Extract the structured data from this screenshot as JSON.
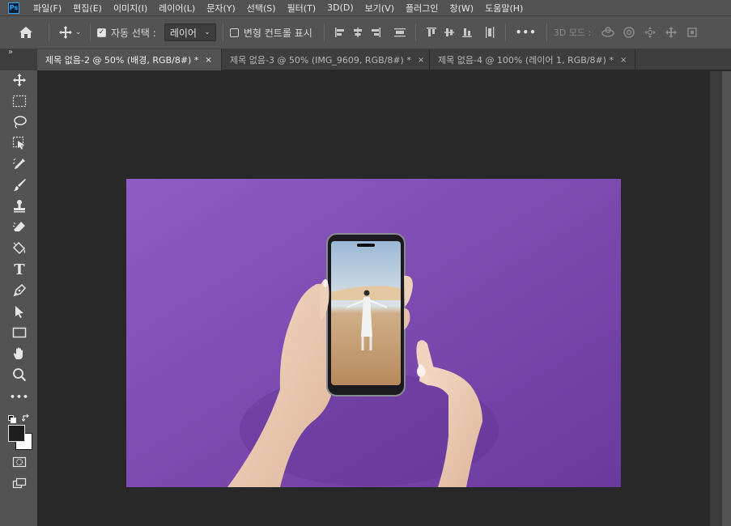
{
  "app": {
    "logo": "Ps"
  },
  "menu": [
    "파일(F)",
    "편집(E)",
    "이미지(I)",
    "레이어(L)",
    "문자(Y)",
    "선택(S)",
    "필터(T)",
    "3D(D)",
    "보기(V)",
    "플러그인",
    "창(W)",
    "도움말(H)"
  ],
  "options": {
    "auto_select_label": "자동 선택 :",
    "auto_select_checked": true,
    "auto_select_target": "레이어",
    "transform_controls_label": "변형 컨트롤 표시",
    "transform_controls_checked": false,
    "more_label": "•••",
    "mode_3d_label": "3D 모드 :"
  },
  "panel_collapse": "»",
  "tabs": [
    {
      "label": "제목 없음-2 @ 50% (배경, RGB/8#) *",
      "active": true,
      "close": "×"
    },
    {
      "label": "제목 없음-3 @ 50% (IMG_9609, RGB/8#) *",
      "active": false,
      "close": "×"
    },
    {
      "label": "제목 없음-4 @ 100% (레이어 1, RGB/8#) *",
      "active": false,
      "close": "×"
    }
  ],
  "tools": [
    "move-tool-icon",
    "marquee-tool-icon",
    "lasso-tool-icon",
    "object-select-tool-icon",
    "eyedropper-tool-icon",
    "brush-tool-icon",
    "clone-stamp-tool-icon",
    "eraser-tool-icon",
    "paint-bucket-tool-icon",
    "type-tool-icon",
    "pen-tool-icon",
    "path-select-tool-icon",
    "rectangle-tool-icon",
    "hand-tool-icon",
    "zoom-tool-icon",
    "more-tools-icon"
  ],
  "type_tool_glyph": "T",
  "more_tools_glyph": "•••",
  "colors": {
    "foreground": "#1e1e1e",
    "background": "#ffffff",
    "ui_panel": "#535353",
    "canvas_bg": "#282828",
    "photo_purple": "#7e4bb0",
    "accent": "#31a8ff"
  }
}
